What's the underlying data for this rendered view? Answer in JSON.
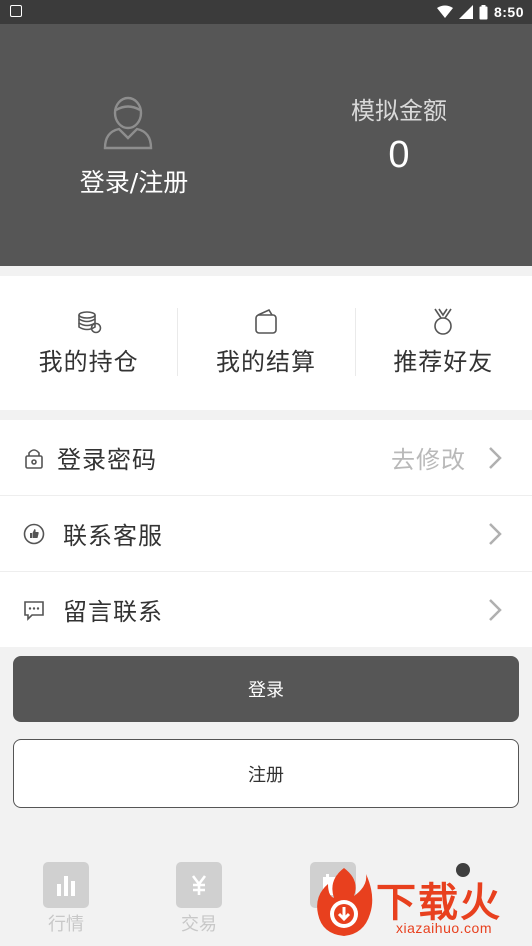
{
  "status_bar": {
    "time": "8:50"
  },
  "profile": {
    "login_register": "登录/注册",
    "balance_label": "模拟金额",
    "balance_value": "0"
  },
  "quick_actions": [
    {
      "label": "我的持仓",
      "icon": "coins-stack-icon"
    },
    {
      "label": "我的结算",
      "icon": "wallet-icon"
    },
    {
      "label": "推荐好友",
      "icon": "medal-icon"
    }
  ],
  "menu": [
    {
      "label": "登录密码",
      "value": "去修改",
      "icon": "lock-icon"
    },
    {
      "label": "联系客服",
      "value": "",
      "icon": "thumbs-up-icon"
    },
    {
      "label": "留言联系",
      "value": "",
      "icon": "message-icon"
    }
  ],
  "buttons": {
    "login": "登录",
    "register": "注册"
  },
  "bottom_nav": [
    {
      "label": "行情",
      "icon": "chart-bars-icon"
    },
    {
      "label": "交易",
      "icon": "yuan-icon"
    },
    {
      "label": "",
      "icon": "calendar-icon"
    },
    {
      "label": "",
      "icon": "profile-icon"
    }
  ],
  "watermark": {
    "brand": "下载火",
    "url": "xiazaihuo.com"
  },
  "colors": {
    "header_bg": "#565656",
    "status_bg": "#3b3b3b",
    "watermark": "#e8401e"
  }
}
